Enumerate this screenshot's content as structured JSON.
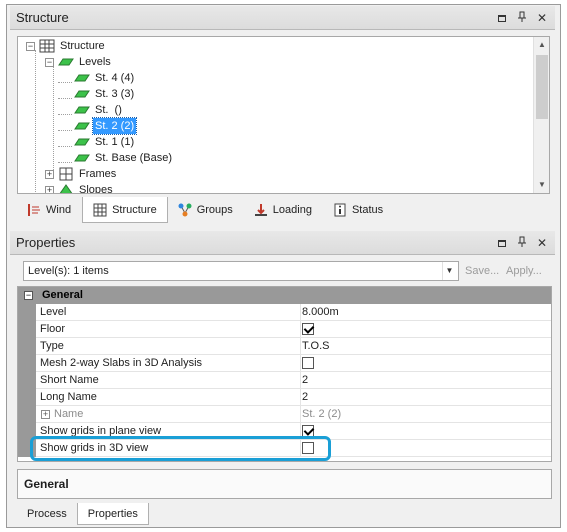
{
  "structure_panel": {
    "title": "Structure",
    "tree": {
      "root": "Structure",
      "levels": "Level s",
      "levels_label": "Levels",
      "items": [
        "St. 4 (4)",
        "St. 3 (3)",
        "St.  ()",
        "St. 2 (2)",
        "St. 1 (1)",
        "St. Base (Base)"
      ],
      "frames": "Frames",
      "slopes": "Slopes"
    },
    "tabs": [
      {
        "label": "Wind"
      },
      {
        "label": "Structure"
      },
      {
        "label": "Groups"
      },
      {
        "label": "Loading"
      },
      {
        "label": "Status"
      }
    ]
  },
  "properties_panel": {
    "title": "Properties",
    "selector": "Level(s): 1 items",
    "save_label": "Save...",
    "apply_label": "Apply...",
    "category": "General",
    "rows": [
      {
        "name": "Level",
        "value": "8.000m"
      },
      {
        "name": "Floor",
        "checked": "yes"
      },
      {
        "name": "Type",
        "value": "T.O.S"
      },
      {
        "name": "Mesh 2-way Slabs in 3D Analysis",
        "checked": "no"
      },
      {
        "name": "Short Name",
        "value": "2"
      },
      {
        "name": "Long Name",
        "value": "2"
      },
      {
        "name": "Name",
        "value": "St. 2 (2)"
      },
      {
        "name": "Show grids in plane view",
        "checked": "yes"
      },
      {
        "name": "Show grids in 3D view",
        "checked": "no"
      }
    ],
    "description_title": "General"
  },
  "bottom_tabs": [
    {
      "label": "Process"
    },
    {
      "label": "Properties"
    }
  ],
  "colors": {
    "selection": "#3399ff",
    "callout": "#1a9fd6",
    "category_bg": "#999999"
  }
}
